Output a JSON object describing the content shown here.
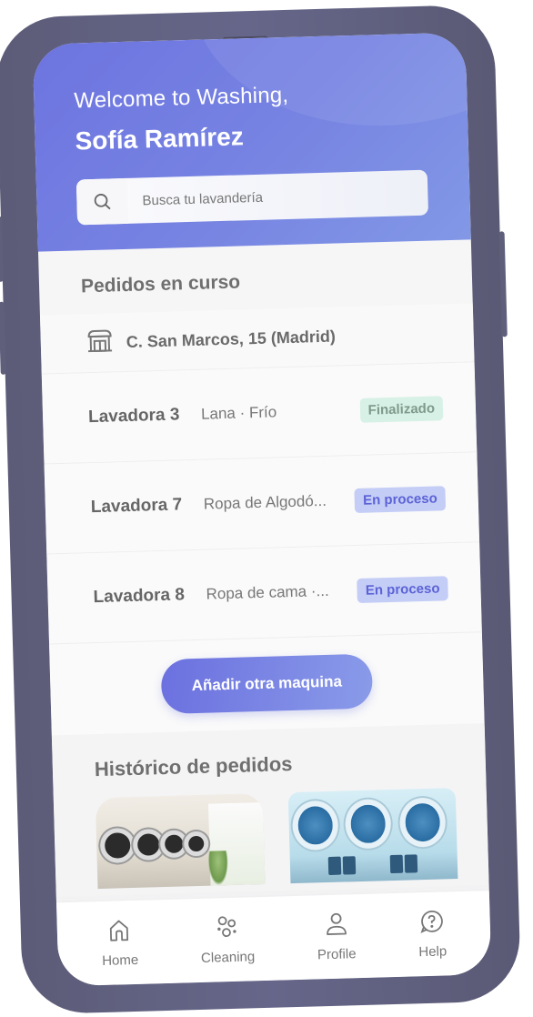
{
  "header": {
    "welcome": "Welcome to Washing,",
    "user_name": "Sofía Ramírez",
    "search_placeholder": "Busca tu lavandería",
    "search_icon": "search-icon"
  },
  "orders": {
    "section_title": "Pedidos en curso",
    "shop": {
      "icon": "storefront-icon",
      "address": "C. San Marcos, 15 (Madrid)"
    },
    "items": [
      {
        "machine": "Lavadora 3",
        "description": "Lana · Frío",
        "status": "Finalizado",
        "status_type": "done"
      },
      {
        "machine": "Lavadora 7",
        "description": "Ropa de Algodó...",
        "status": "En proceso",
        "status_type": "progress"
      },
      {
        "machine": "Lavadora 8",
        "description": "Ropa de cama ·...",
        "status": "En proceso",
        "status_type": "progress"
      }
    ],
    "add_button": "Añadir otra maquina"
  },
  "history": {
    "section_title": "Histórico de pedidos",
    "thumbnails": [
      "laundromat-room-image",
      "washing-machines-image"
    ]
  },
  "tabbar": {
    "items": [
      {
        "label": "Home",
        "icon": "home-icon"
      },
      {
        "label": "Cleaning",
        "icon": "bubbles-icon"
      },
      {
        "label": "Profile",
        "icon": "user-icon"
      },
      {
        "label": "Help",
        "icon": "help-icon"
      }
    ]
  },
  "colors": {
    "brand": "#6d74e0",
    "badge_done_bg": "#d8f1e6",
    "badge_progress_bg": "#c4cdf6",
    "badge_progress_text": "#5c63d6",
    "phone_frame": "#5f5f7c"
  }
}
